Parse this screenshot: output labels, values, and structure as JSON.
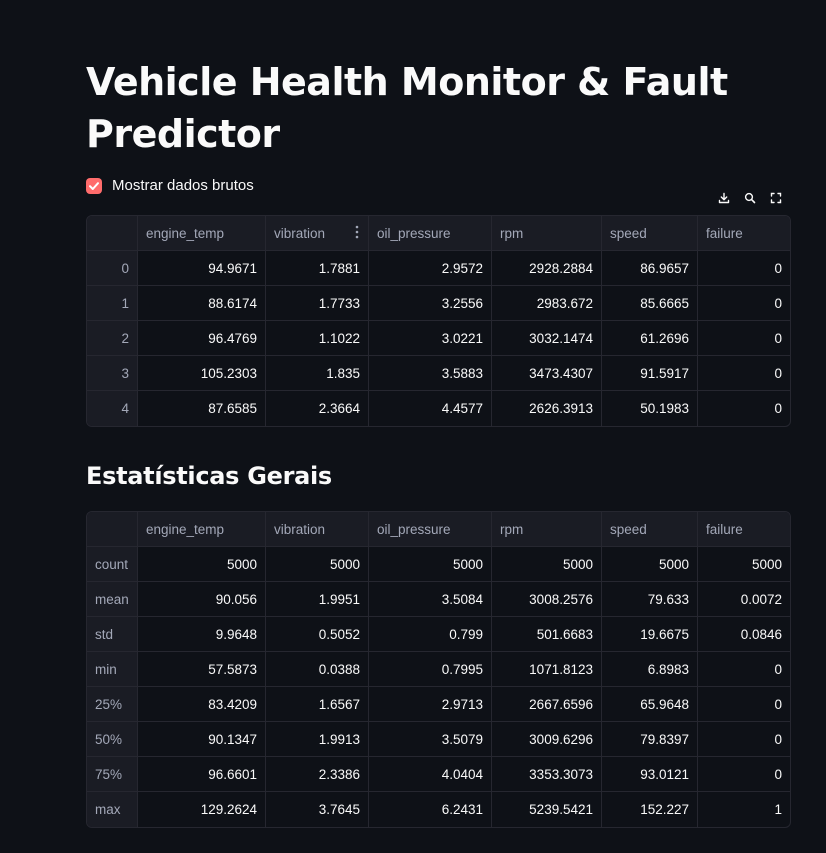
{
  "page": {
    "title": "Vehicle Health Monitor & Fault Predictor",
    "checkbox_label": "Mostrar dados brutos",
    "checkbox_checked": true,
    "stats_title": "Estatísticas Gerais"
  },
  "colors": {
    "background": "#0e1117",
    "accent": "#ff6c6c",
    "border": "#262730",
    "header_text": "#a3a8b8"
  },
  "toolbar": {
    "icons": [
      "download-icon",
      "search-icon",
      "fullscreen-icon"
    ]
  },
  "columns": [
    "engine_temp",
    "vibration",
    "oil_pressure",
    "rpm",
    "speed",
    "failure"
  ],
  "raw_rows": [
    {
      "index": "0",
      "values": [
        "94.9671",
        "1.7881",
        "2.9572",
        "2928.2884",
        "86.9657",
        "0"
      ]
    },
    {
      "index": "1",
      "values": [
        "88.6174",
        "1.7733",
        "3.2556",
        "2983.672",
        "85.6665",
        "0"
      ]
    },
    {
      "index": "2",
      "values": [
        "96.4769",
        "1.1022",
        "3.0221",
        "3032.1474",
        "61.2696",
        "0"
      ]
    },
    {
      "index": "3",
      "values": [
        "105.2303",
        "1.835",
        "3.5883",
        "3473.4307",
        "91.5917",
        "0"
      ]
    },
    {
      "index": "4",
      "values": [
        "87.6585",
        "2.3664",
        "4.4577",
        "2626.3913",
        "50.1983",
        "0"
      ]
    }
  ],
  "stats_rows": [
    {
      "index": "count",
      "values": [
        "5000",
        "5000",
        "5000",
        "5000",
        "5000",
        "5000"
      ]
    },
    {
      "index": "mean",
      "values": [
        "90.056",
        "1.9951",
        "3.5084",
        "3008.2576",
        "79.633",
        "0.0072"
      ]
    },
    {
      "index": "std",
      "values": [
        "9.9648",
        "0.5052",
        "0.799",
        "501.6683",
        "19.6675",
        "0.0846"
      ]
    },
    {
      "index": "min",
      "values": [
        "57.5873",
        "0.0388",
        "0.7995",
        "1071.8123",
        "6.8983",
        "0"
      ]
    },
    {
      "index": "25%",
      "values": [
        "83.4209",
        "1.6567",
        "2.9713",
        "2667.6596",
        "65.9648",
        "0"
      ]
    },
    {
      "index": "50%",
      "values": [
        "90.1347",
        "1.9913",
        "3.5079",
        "3009.6296",
        "79.8397",
        "0"
      ]
    },
    {
      "index": "75%",
      "values": [
        "96.6601",
        "2.3386",
        "4.0404",
        "3353.3073",
        "93.0121",
        "0"
      ]
    },
    {
      "index": "max",
      "values": [
        "129.2624",
        "3.7645",
        "6.2431",
        "5239.5421",
        "152.227",
        "1"
      ]
    }
  ]
}
